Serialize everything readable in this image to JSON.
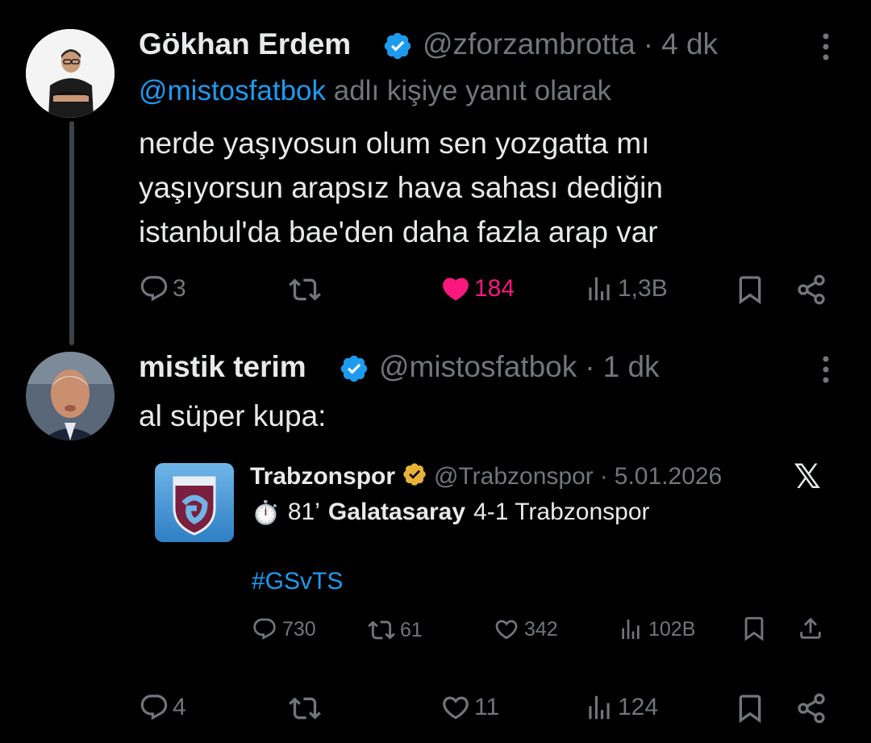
{
  "tweet1": {
    "author_name": "Gökhan Erdem",
    "handle": "@zforzambrotta",
    "separator": "·",
    "time": "4 dk",
    "reply_prefix_mention": "@mistosfatbok",
    "reply_suffix": "adlı kişiye yanıt olarak",
    "text_lines": [
      "nerde yaşıyosun olum sen yozgatta mı",
      "yaşıyorsun arapsız hava sahası dediğin",
      "istanbul'da bae'den daha fazla arap var"
    ],
    "actions": {
      "replies": "3",
      "likes": "184",
      "views": "1,3B"
    },
    "like_color": "#f91880"
  },
  "tweet2": {
    "author_name": "mistik terim",
    "handle": "@mistosfatbok",
    "separator": "·",
    "time": "1 dk",
    "text": "al süper kupa:",
    "actions": {
      "replies": "4",
      "likes": "11",
      "views": "124"
    }
  },
  "quote": {
    "author_name": "Trabzonspor",
    "handle": "@Trabzonspor",
    "separator": "·",
    "date": "5.01.2026",
    "stopwatch": "⏱️",
    "minute": "81’",
    "team_home": "Galatasaray",
    "score_line": "4-1 Trabzonspor",
    "hashtag": "#GSvTS",
    "platform_logo": "𝕏",
    "actions": {
      "replies": "730",
      "retweets": "61",
      "likes": "342",
      "views": "102B"
    }
  },
  "colors": {
    "accent": "#1d9bf0",
    "muted": "#71767b",
    "text": "#e7e9ea",
    "gold_badge": "#e8b339"
  },
  "icons": [
    "verified-badge-icon",
    "gold-verified-badge-icon",
    "more-icon",
    "reply-icon",
    "retweet-icon",
    "like-icon",
    "views-icon",
    "bookmark-icon",
    "share-icon",
    "upload-icon",
    "stopwatch-icon",
    "x-logo-icon"
  ]
}
